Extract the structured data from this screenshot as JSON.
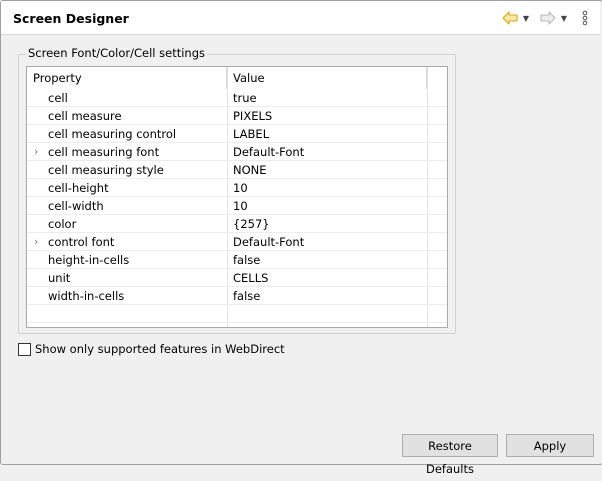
{
  "header": {
    "title": "Screen Designer",
    "back_icon": "arrow-left-icon",
    "forward_icon": "arrow-right-icon",
    "menu_icon": "vertical-ellipsis-icon"
  },
  "group": {
    "label": "Screen Font/Color/Cell settings"
  },
  "table": {
    "columns": [
      "Property",
      "Value"
    ],
    "rows": [
      {
        "property": "cell",
        "value": "true",
        "expandable": false
      },
      {
        "property": "cell measure",
        "value": "PIXELS",
        "expandable": false
      },
      {
        "property": "cell measuring control",
        "value": "LABEL",
        "expandable": false
      },
      {
        "property": "cell measuring font",
        "value": "Default-Font",
        "expandable": true
      },
      {
        "property": "cell measuring style",
        "value": "NONE",
        "expandable": false
      },
      {
        "property": "cell-height",
        "value": "10",
        "expandable": false
      },
      {
        "property": "cell-width",
        "value": "10",
        "expandable": false
      },
      {
        "property": "color",
        "value": "{257}",
        "expandable": false
      },
      {
        "property": "control font",
        "value": "Default-Font",
        "expandable": true
      },
      {
        "property": "height-in-cells",
        "value": "false",
        "expandable": false
      },
      {
        "property": "unit",
        "value": "CELLS",
        "expandable": false
      },
      {
        "property": "width-in-cells",
        "value": "false",
        "expandable": false
      }
    ]
  },
  "options": {
    "webdirect_checkbox_label": "Show only supported features in WebDirect",
    "webdirect_checked": false
  },
  "buttons": {
    "restore_defaults": "Restore Defaults",
    "apply": "Apply"
  },
  "colors": {
    "back_arrow": "#f5c242",
    "forward_arrow": "#b9b9b9"
  }
}
